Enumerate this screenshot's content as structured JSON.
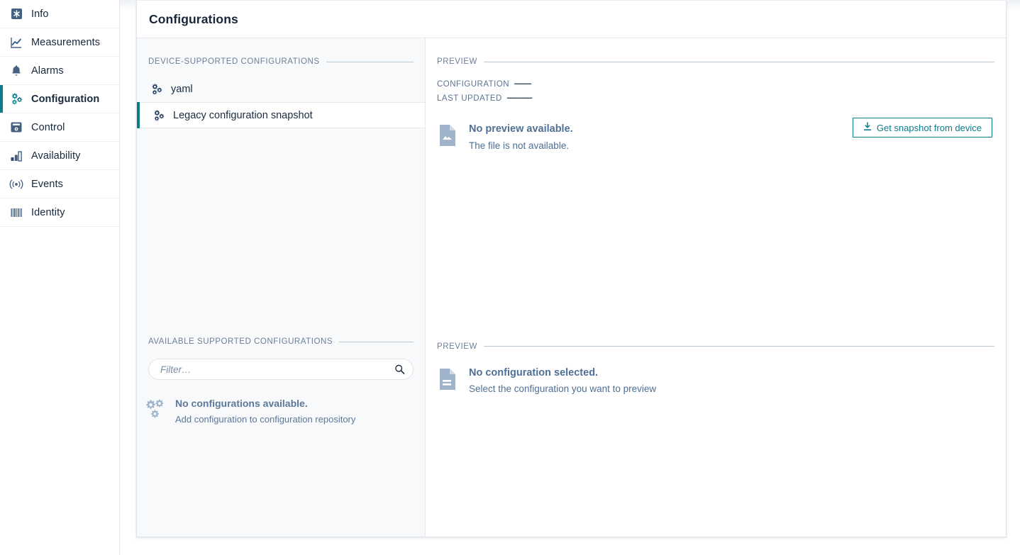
{
  "sidebar": {
    "items": [
      {
        "label": "Info",
        "icon": "info-asterisk-icon",
        "active": false
      },
      {
        "label": "Measurements",
        "icon": "line-chart-icon",
        "active": false
      },
      {
        "label": "Alarms",
        "icon": "bell-icon",
        "active": false
      },
      {
        "label": "Configuration",
        "icon": "gears-icon",
        "active": true
      },
      {
        "label": "Control",
        "icon": "device-control-icon",
        "active": false
      },
      {
        "label": "Availability",
        "icon": "bar-chart-icon",
        "active": false
      },
      {
        "label": "Events",
        "icon": "broadcast-icon",
        "active": false
      },
      {
        "label": "Identity",
        "icon": "barcode-icon",
        "active": false
      }
    ]
  },
  "card": {
    "title": "Configurations"
  },
  "device_supported": {
    "section_label": "DEVICE-SUPPORTED CONFIGURATIONS",
    "items": [
      {
        "label": "yaml",
        "icon": "gears-icon",
        "selected": false
      },
      {
        "label": "Legacy configuration snapshot",
        "icon": "gears-icon",
        "selected": true
      }
    ]
  },
  "available_supported": {
    "section_label": "AVAILABLE SUPPORTED CONFIGURATIONS",
    "filter": {
      "value": "",
      "placeholder": "Filter…",
      "icon": "search-icon"
    },
    "empty": {
      "icon": "gears-icon",
      "title": "No configurations available.",
      "subtitle": "Add configuration to configuration repository"
    }
  },
  "preview_top": {
    "section_label": "PREVIEW",
    "meta": [
      {
        "key": "CONFIGURATION",
        "value": "——"
      },
      {
        "key": "LAST UPDATED",
        "value": "———"
      }
    ],
    "action": {
      "label": "Get snapshot from device",
      "icon": "download-icon"
    },
    "empty": {
      "icon": "image-file-icon",
      "title": "No preview available.",
      "subtitle": "The file is not available."
    }
  },
  "preview_bottom": {
    "section_label": "PREVIEW",
    "empty": {
      "icon": "text-file-icon",
      "title": "No configuration selected.",
      "subtitle": "Select the configuration you want to preview"
    }
  },
  "colors": {
    "accent": "#0b7b8a",
    "text_dark": "#17263b",
    "muted": "#6c7f97",
    "panel_bg": "#f8f9fb"
  }
}
